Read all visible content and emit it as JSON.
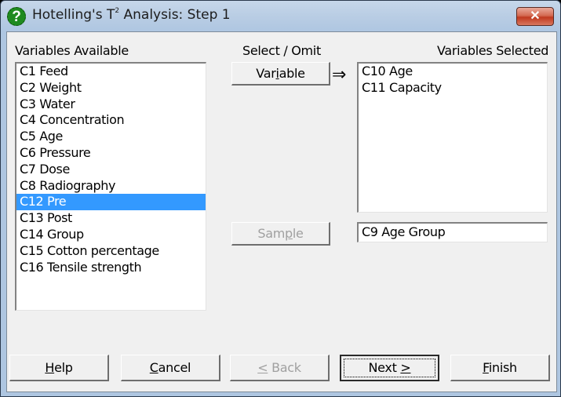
{
  "window": {
    "title_prefix": "Hotelling's T",
    "title_sup": "2",
    "title_suffix": " Analysis: Step 1",
    "app_icon": "help-question-icon",
    "close_glyph": "✕"
  },
  "available": {
    "label": "Variables Available",
    "items": [
      "C1 Feed",
      "C2 Weight",
      "C3 Water",
      "C4 Concentration",
      "C5 Age",
      "C6 Pressure",
      "C7 Dose",
      "C8 Radiography",
      "C12 Pre",
      "C13 Post",
      "C14 Group",
      "C15 Cotton percentage",
      "C16 Tensile strength"
    ],
    "selected_index": 8
  },
  "select_omit": {
    "label": "Select / Omit",
    "variable_button": {
      "pre": "Var",
      "accel": "i",
      "post": "able"
    },
    "arrow_glyph": "⇒",
    "sample_button": {
      "pre": "Sam",
      "accel": "p",
      "post": "le"
    }
  },
  "selected": {
    "label": "Variables Selected",
    "items": [
      "C10 Age",
      "C11 Capacity"
    ],
    "sample_value": "C9 Age Group"
  },
  "footer": {
    "help": {
      "accel": "H",
      "post": "elp"
    },
    "cancel": {
      "accel": "C",
      "post": "ancel"
    },
    "back": {
      "accel": "<",
      "post": " Back"
    },
    "next": {
      "pre": "Next ",
      "accel": ">"
    },
    "finish": {
      "accel": "F",
      "post": "inish"
    }
  }
}
